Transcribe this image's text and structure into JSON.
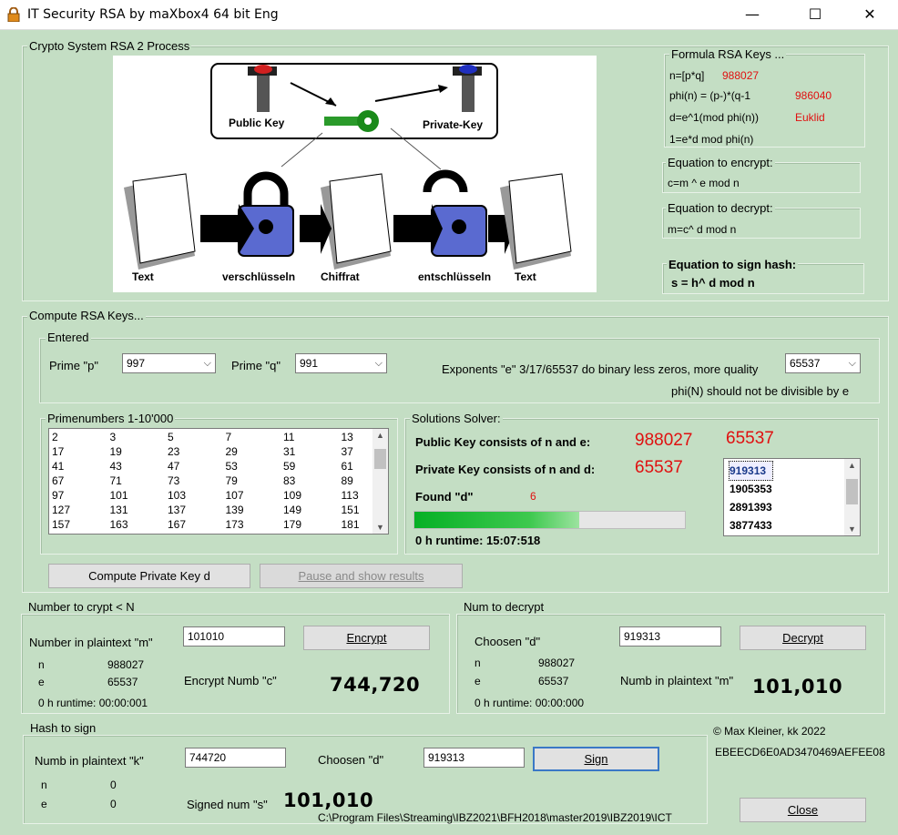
{
  "window": {
    "title": "IT Security RSA by maXbox4 64 bit Eng",
    "minimize": "—",
    "maximize": "☐",
    "close": "✕"
  },
  "process": {
    "group_title": "Crypto System RSA 2 Process",
    "diagram": {
      "public_key": "Public Key",
      "private_key": "Private-Key",
      "text1": "Text",
      "encrypt": "verschlüsseln",
      "cipher": "Chiffrat",
      "decrypt": "entschlüsseln",
      "text2": "Text"
    }
  },
  "formula": {
    "group_title": "Formula RSA Keys ...",
    "n_label": "n=[p*q]",
    "n_value": "988027",
    "phi_label": "phi(n) = (p-)*(q-1",
    "phi_value": "986040",
    "d_label": "d=e^1(mod phi(n))",
    "d_value": "Euklid",
    "one_label": "1=e*d mod phi(n)"
  },
  "encrypt_eq": {
    "group_title": "Equation to encrypt:",
    "text": "c=m ^ e mod n"
  },
  "decrypt_eq": {
    "group_title": "Equation to decrypt:",
    "text": "m=c^ d mod n"
  },
  "sign_eq": {
    "title": "Equation to sign hash:",
    "text": "s = h^ d mod n"
  },
  "compute": {
    "group_title": "Compute RSA Keys...",
    "entered_title": "Entered",
    "prime_p_label": "Prime \"p\"",
    "prime_p": "997",
    "prime_q_label": "Prime \"q\"",
    "prime_q": "991",
    "exponent_label": "Exponents \"e\" 3/17/65537 do binary less zeros, more quality",
    "exponent": "65537",
    "phi_note": "phi(N) should not be divisible by e",
    "primes_title": "Primenumbers 1-10'000",
    "primes": [
      [
        "2",
        "3",
        "5",
        "7",
        "11",
        "13"
      ],
      [
        "17",
        "19",
        "23",
        "29",
        "31",
        "37"
      ],
      [
        "41",
        "43",
        "47",
        "53",
        "59",
        "61"
      ],
      [
        "67",
        "71",
        "73",
        "79",
        "83",
        "89"
      ],
      [
        "97",
        "101",
        "103",
        "107",
        "109",
        "113"
      ],
      [
        "127",
        "131",
        "137",
        "139",
        "149",
        "151"
      ],
      [
        "157",
        "163",
        "167",
        "173",
        "179",
        "181"
      ]
    ],
    "solver_title": "Solutions Solver:",
    "public_key_label": "Public Key consists of n and e:",
    "public_n": "988027",
    "public_e": "65537",
    "private_key_label": "Private Key consists of n and d:",
    "private_e": "65537",
    "found_d_label": "Found \"d\"",
    "found_d_count": "6",
    "progress": 0.61,
    "runtime": "0 h runtime: 15:07:518",
    "d_candidates": [
      "919313",
      "1905353",
      "2891393",
      "3877433"
    ],
    "compute_btn": "Compute Private Key d",
    "pause_btn": "Pause and show results"
  },
  "crypt": {
    "group_title": "Number to crypt < N",
    "plaintext_label": "Number in plaintext \"m\"",
    "plaintext": "101010",
    "encrypt_btn": "Encrypt",
    "n_label": "n",
    "n_value": "988027",
    "e_label": "e",
    "e_value": "65537",
    "result_label": "Encrypt Numb \"c\"",
    "result": "744,720",
    "runtime": "0 h runtime: 00:00:001"
  },
  "decrypt": {
    "group_title": "Num to decrypt",
    "d_label": "Choosen \"d\"",
    "d_value": "919313",
    "decrypt_btn": "Decrypt",
    "n_label": "n",
    "n_value": "988027",
    "e_label": "e",
    "e_value": "65537",
    "result_label": "Numb in plaintext \"m\"",
    "result": "101,010",
    "runtime": "0 h runtime: 00:00:000"
  },
  "hash": {
    "group_title": "Hash to sign",
    "plaintext_label": "Numb in plaintext \"k\"",
    "plaintext": "744720",
    "d_label": "Choosen \"d\"",
    "d_value": "919313",
    "sign_btn": "Sign",
    "n_label": "n",
    "n_value": "0",
    "e_label": "e",
    "e_value": "0",
    "signed_label": "Signed num \"s\"",
    "signed": "101,010"
  },
  "footer": {
    "copyright": "© Max Kleiner,  kk 2022",
    "hash_hex": "EBEECD6E0AD3470469AEFEE08",
    "path": "C:\\Program Files\\Streaming\\IBZ2021\\BFH2018\\master2019\\IBZ2019\\ICT",
    "close_btn": "Close"
  }
}
